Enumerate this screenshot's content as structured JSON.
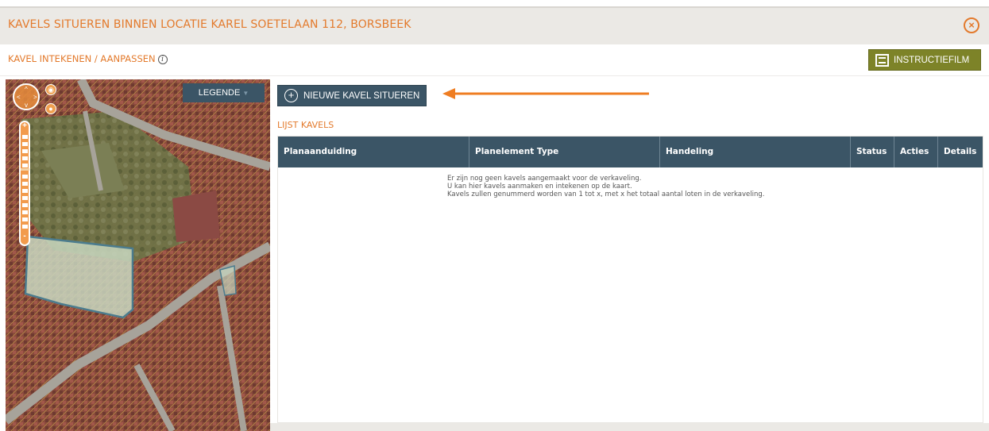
{
  "window": {
    "title": "KAVELS SITUEREN BINNEN LOCATIE KAREL SOETELAAN 112, BORSBEEK",
    "close_icon": "close-circle-icon"
  },
  "subbar": {
    "title": "KAVEL INTEKENEN / AANPASSEN",
    "info_icon": "info-icon",
    "film_button": "INSTRUCTIEFILM"
  },
  "map": {
    "legend_button": "LEGENDE",
    "zoom_in": "+",
    "zoom_out": "-"
  },
  "main": {
    "new_button": "NIEUWE KAVEL SITUEREN",
    "list_title": "LIJST KAVELS",
    "table": {
      "columns": [
        "Planaanduiding",
        "Planelement Type",
        "Handeling",
        "Status",
        "Acties",
        "Details"
      ],
      "empty_lines": [
        "Er zijn nog geen kavels aangemaakt voor de verkaveling.",
        "U kan hier kavels aanmaken en intekenen op de kaart.",
        "Kavels zullen genummerd worden van 1 tot x, met x het totaal aantal loten in de verkaveling."
      ]
    }
  },
  "colors": {
    "accent_orange": "#e37a2c",
    "header_blue": "#3b5566",
    "film_green": "#7d8328",
    "arrow_orange": "#ef7d22"
  }
}
